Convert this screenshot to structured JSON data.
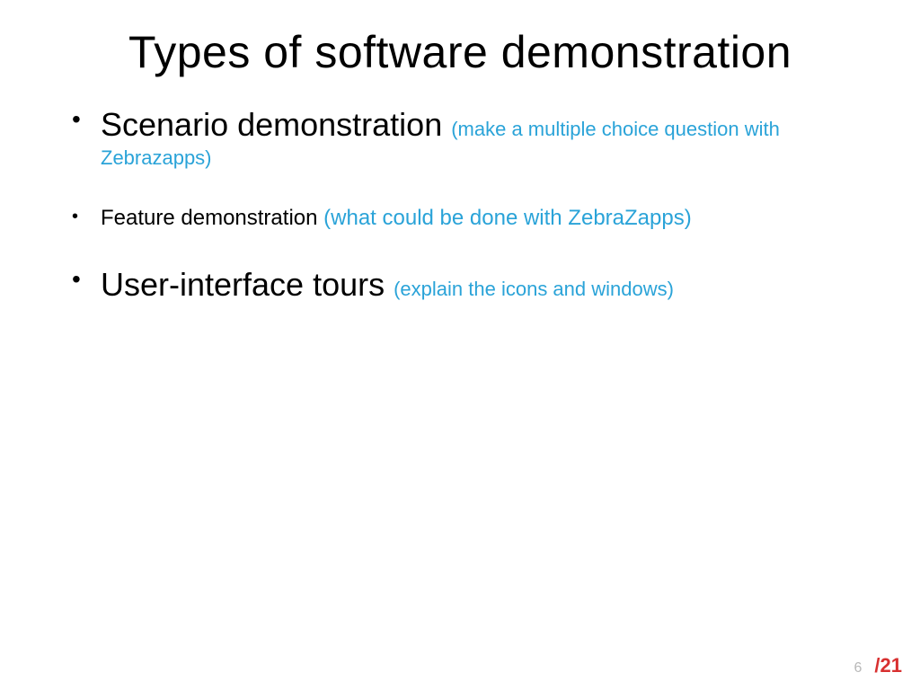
{
  "title": "Types of software demonstration",
  "bullets": [
    {
      "main": "Scenario demonstration ",
      "paren": "(make a multiple choice question with Zebrazapps)",
      "mainClass": "main-text-large",
      "parenClass": "paren-text-med",
      "itemClass": ""
    },
    {
      "main": "Feature demonstration ",
      "paren": "(what could be done with ZebraZapps)",
      "mainClass": "main-text-small",
      "parenClass": "paren-text-small",
      "itemClass": "small-bullet"
    },
    {
      "main": "User-interface tours ",
      "paren": "(explain the icons and windows)",
      "mainClass": "main-text-large",
      "parenClass": "paren-text-med2",
      "itemClass": ""
    }
  ],
  "footer": {
    "page": "6",
    "total": "/21"
  }
}
